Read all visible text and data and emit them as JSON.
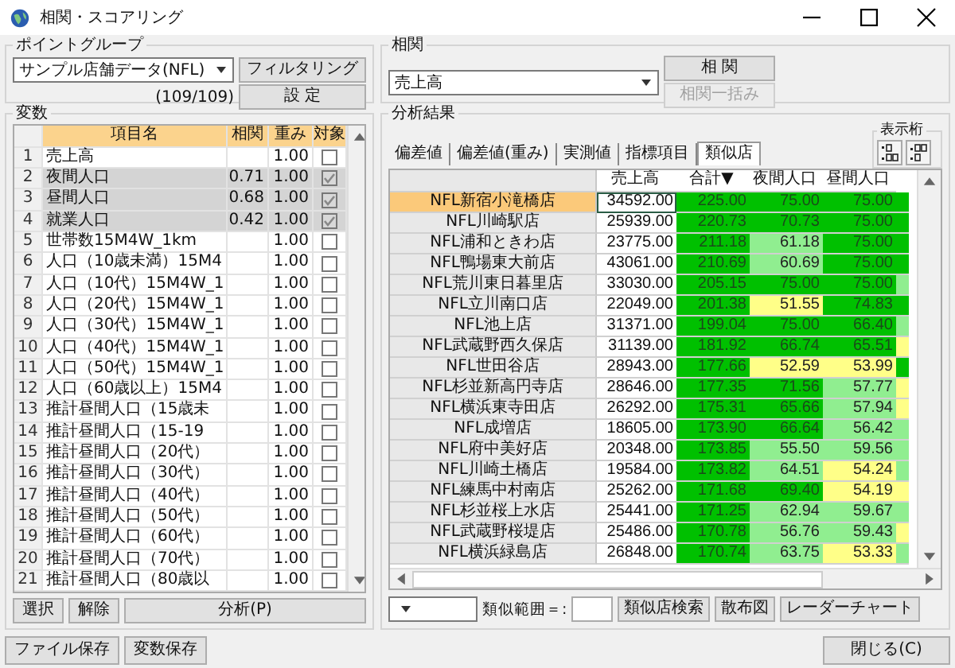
{
  "window": {
    "title": "相関・スコアリング"
  },
  "point_group": {
    "label": "ポイントグループ",
    "value": "サンプル店舗データ(NFL)",
    "count": "(109/109)",
    "buttons": [
      "フィルタリング",
      "設 定"
    ]
  },
  "correlation": {
    "label": "相関",
    "value": "売上高",
    "buttons": [
      {
        "label": "相 関",
        "disabled": false
      },
      {
        "label": "相関一括み",
        "disabled": true
      }
    ]
  },
  "variables": {
    "label": "変数",
    "columns": [
      "項目名",
      "相関",
      "重み",
      "対象"
    ],
    "rows": [
      {
        "no": "1",
        "name": "売上高",
        "weight": "1.00",
        "checked": false,
        "selected": false
      },
      {
        "no": "2",
        "name": "夜間人口",
        "corr": "0.71",
        "weight": "1.00",
        "checked": true,
        "selected": true
      },
      {
        "no": "3",
        "name": "昼間人口",
        "corr": "0.68",
        "weight": "1.00",
        "checked": true,
        "selected": true
      },
      {
        "no": "4",
        "name": "就業人口",
        "corr": "0.42",
        "weight": "1.00",
        "checked": true,
        "selected": true
      },
      {
        "no": "5",
        "name": "世帯数15M4W_1km",
        "weight": "1.00",
        "checked": false,
        "selected": false
      },
      {
        "no": "6",
        "name": "人口（10歳未満）15M4",
        "weight": "1.00",
        "checked": false,
        "selected": false
      },
      {
        "no": "7",
        "name": "人口（10代）15M4W_1",
        "weight": "1.00",
        "checked": false,
        "selected": false
      },
      {
        "no": "8",
        "name": "人口（20代）15M4W_1",
        "weight": "1.00",
        "checked": false,
        "selected": false
      },
      {
        "no": "9",
        "name": "人口（30代）15M4W_1",
        "weight": "1.00",
        "checked": false,
        "selected": false
      },
      {
        "no": "10",
        "name": "人口（40代）15M4W_1",
        "weight": "1.00",
        "checked": false,
        "selected": false
      },
      {
        "no": "11",
        "name": "人口（50代）15M4W_1",
        "weight": "1.00",
        "checked": false,
        "selected": false
      },
      {
        "no": "12",
        "name": "人口（60歳以上）15M4",
        "weight": "1.00",
        "checked": false,
        "selected": false
      },
      {
        "no": "13",
        "name": "推計昼間人口（15歳未",
        "weight": "1.00",
        "checked": false,
        "selected": false
      },
      {
        "no": "14",
        "name": "推計昼間人口（15-19",
        "weight": "1.00",
        "checked": false,
        "selected": false
      },
      {
        "no": "15",
        "name": "推計昼間人口（20代）",
        "weight": "1.00",
        "checked": false,
        "selected": false
      },
      {
        "no": "16",
        "name": "推計昼間人口（30代）",
        "weight": "1.00",
        "checked": false,
        "selected": false
      },
      {
        "no": "17",
        "name": "推計昼間人口（40代）",
        "weight": "1.00",
        "checked": false,
        "selected": false
      },
      {
        "no": "18",
        "name": "推計昼間人口（50代）",
        "weight": "1.00",
        "checked": false,
        "selected": false
      },
      {
        "no": "19",
        "name": "推計昼間人口（60代）",
        "weight": "1.00",
        "checked": false,
        "selected": false
      },
      {
        "no": "20",
        "name": "推計昼間人口（70代）",
        "weight": "1.00",
        "checked": false,
        "selected": false
      },
      {
        "no": "21",
        "name": "推計昼間人口（80歳以",
        "weight": "1.00",
        "checked": false,
        "selected": false
      }
    ]
  },
  "variable_buttons": [
    "選択",
    "解除",
    "分析(P)"
  ],
  "results": {
    "label": "分析結果",
    "digits_label": "表示桁",
    "tabs": [
      {
        "label": "偏差値",
        "selected": false
      },
      {
        "label": "偏差値(重み)",
        "selected": false
      },
      {
        "label": "実測値",
        "selected": false
      },
      {
        "label": "指標項目",
        "selected": false
      },
      {
        "label": "類似店",
        "selected": true
      }
    ],
    "columns": [
      "",
      "売上高",
      "合計▼",
      "夜間人口",
      "昼間人口"
    ],
    "rows": [
      {
        "selected": true,
        "cells": [
          {
            "text": "NFL新宿小滝橋店"
          },
          {
            "text": "34592.00"
          },
          {
            "text": "225.00",
            "color": "#00c000"
          },
          {
            "text": "75.00",
            "color": "#00c000"
          },
          {
            "text": "75.00",
            "color": "#00c000"
          },
          {
            "color": "#00c000"
          }
        ]
      },
      {
        "selected": false,
        "cells": [
          {
            "text": "NFL川崎駅店"
          },
          {
            "text": "25939.00"
          },
          {
            "text": "220.73",
            "color": "#00c000"
          },
          {
            "text": "70.73",
            "color": "#00c000"
          },
          {
            "text": "75.00",
            "color": "#00c000"
          },
          {
            "color": "#00c000"
          }
        ]
      },
      {
        "selected": false,
        "cells": [
          {
            "text": "NFL浦和ときわ店"
          },
          {
            "text": "23775.00"
          },
          {
            "text": "211.18",
            "color": "#00c000"
          },
          {
            "text": "61.18",
            "color": "#90ee90"
          },
          {
            "text": "75.00",
            "color": "#00c000"
          },
          {
            "color": "#00c000"
          }
        ]
      },
      {
        "selected": false,
        "cells": [
          {
            "text": "NFL鴨場東大前店"
          },
          {
            "text": "43061.00"
          },
          {
            "text": "210.69",
            "color": "#00c000"
          },
          {
            "text": "60.69",
            "color": "#90ee90"
          },
          {
            "text": "75.00",
            "color": "#00c000"
          },
          {
            "color": "#00c000"
          }
        ]
      },
      {
        "selected": false,
        "cells": [
          {
            "text": "NFL荒川東日暮里店"
          },
          {
            "text": "33030.00"
          },
          {
            "text": "205.15",
            "color": "#00c000"
          },
          {
            "text": "75.00",
            "color": "#00c000"
          },
          {
            "text": "75.00",
            "color": "#00c000"
          },
          {
            "color": "#90ee90"
          }
        ]
      },
      {
        "selected": false,
        "cells": [
          {
            "text": "NFL立川南口店"
          },
          {
            "text": "22049.00"
          },
          {
            "text": "201.38",
            "color": "#00c000"
          },
          {
            "text": "51.55",
            "color": "#ffff88"
          },
          {
            "text": "74.83",
            "color": "#00c000"
          },
          {
            "color": "#00c000"
          }
        ]
      },
      {
        "selected": false,
        "cells": [
          {
            "text": "NFL池上店"
          },
          {
            "text": "31371.00"
          },
          {
            "text": "199.04",
            "color": "#00c000"
          },
          {
            "text": "75.00",
            "color": "#00c000"
          },
          {
            "text": "66.40",
            "color": "#00c000"
          },
          {
            "color": "#90ee90"
          }
        ]
      },
      {
        "selected": false,
        "cells": [
          {
            "text": "NFL武蔵野西久保店"
          },
          {
            "text": "31139.00"
          },
          {
            "text": "181.92",
            "color": "#00c000"
          },
          {
            "text": "66.74",
            "color": "#00c000"
          },
          {
            "text": "65.51",
            "color": "#00c000"
          },
          {
            "color": "#ffff88"
          }
        ]
      },
      {
        "selected": false,
        "cells": [
          {
            "text": "NFL世田谷店"
          },
          {
            "text": "28943.00"
          },
          {
            "text": "177.66",
            "color": "#00c000"
          },
          {
            "text": "52.59",
            "color": "#ffff88"
          },
          {
            "text": "53.99",
            "color": "#ffff88"
          },
          {
            "color": "#00c000"
          }
        ]
      },
      {
        "selected": false,
        "cells": [
          {
            "text": "NFL杉並新高円寺店"
          },
          {
            "text": "28646.00"
          },
          {
            "text": "177.35",
            "color": "#00c000"
          },
          {
            "text": "71.56",
            "color": "#00c000"
          },
          {
            "text": "57.77",
            "color": "#90ee90"
          },
          {
            "color": "#ffff88"
          }
        ]
      },
      {
        "selected": false,
        "cells": [
          {
            "text": "NFL横浜東寺田店"
          },
          {
            "text": "26292.00"
          },
          {
            "text": "175.31",
            "color": "#00c000"
          },
          {
            "text": "65.66",
            "color": "#00c000"
          },
          {
            "text": "57.94",
            "color": "#90ee90"
          },
          {
            "color": "#ffff88"
          }
        ]
      },
      {
        "selected": false,
        "cells": [
          {
            "text": "NFL成増店"
          },
          {
            "text": "18605.00"
          },
          {
            "text": "173.90",
            "color": "#00c000"
          },
          {
            "text": "66.64",
            "color": "#00c000"
          },
          {
            "text": "56.42",
            "color": "#90ee90"
          },
          {
            "color": "#90ee90"
          }
        ]
      },
      {
        "selected": false,
        "cells": [
          {
            "text": "NFL府中美好店"
          },
          {
            "text": "20348.00"
          },
          {
            "text": "173.85",
            "color": "#00c000"
          },
          {
            "text": "55.50",
            "color": "#90ee90"
          },
          {
            "text": "59.56",
            "color": "#90ee90"
          },
          {
            "color": "#90ee90"
          }
        ]
      },
      {
        "selected": false,
        "cells": [
          {
            "text": "NFL川崎土橋店"
          },
          {
            "text": "19584.00"
          },
          {
            "text": "173.82",
            "color": "#00c000"
          },
          {
            "text": "64.51",
            "color": "#90ee90"
          },
          {
            "text": "54.24",
            "color": "#ffff88"
          },
          {
            "color": "#90ee90"
          }
        ]
      },
      {
        "selected": false,
        "cells": [
          {
            "text": "NFL練馬中村南店"
          },
          {
            "text": "25262.00"
          },
          {
            "text": "171.68",
            "color": "#00c000"
          },
          {
            "text": "69.40",
            "color": "#00c000"
          },
          {
            "text": "54.19",
            "color": "#ffff88"
          },
          {
            "color": "#ffff88"
          }
        ]
      },
      {
        "selected": false,
        "cells": [
          {
            "text": "NFL杉並桜上水店"
          },
          {
            "text": "25441.00"
          },
          {
            "text": "171.25",
            "color": "#00c000"
          },
          {
            "text": "62.94",
            "color": "#90ee90"
          },
          {
            "text": "59.67",
            "color": "#90ee90"
          },
          {
            "color": "#90ee90"
          }
        ]
      },
      {
        "selected": false,
        "cells": [
          {
            "text": "NFL武蔵野桜堤店"
          },
          {
            "text": "25486.00"
          },
          {
            "text": "170.78",
            "color": "#00c000"
          },
          {
            "text": "56.76",
            "color": "#90ee90"
          },
          {
            "text": "59.43",
            "color": "#90ee90"
          },
          {
            "color": "#ffff88"
          }
        ]
      },
      {
        "selected": false,
        "cells": [
          {
            "text": "NFL横浜緑島店"
          },
          {
            "text": "26848.00"
          },
          {
            "text": "170.74",
            "color": "#00c000"
          },
          {
            "text": "63.75",
            "color": "#90ee90"
          },
          {
            "text": "53.33",
            "color": "#ffff88"
          },
          {
            "color": "#90ee90"
          }
        ]
      }
    ]
  },
  "search": {
    "range_label": "類似範囲＝:",
    "buttons": [
      "類似店検索",
      "散布図",
      "レーダーチャート"
    ]
  },
  "footer": {
    "buttons": [
      "ファイル保存",
      "変数保存"
    ],
    "close": "閉じる(C)"
  }
}
